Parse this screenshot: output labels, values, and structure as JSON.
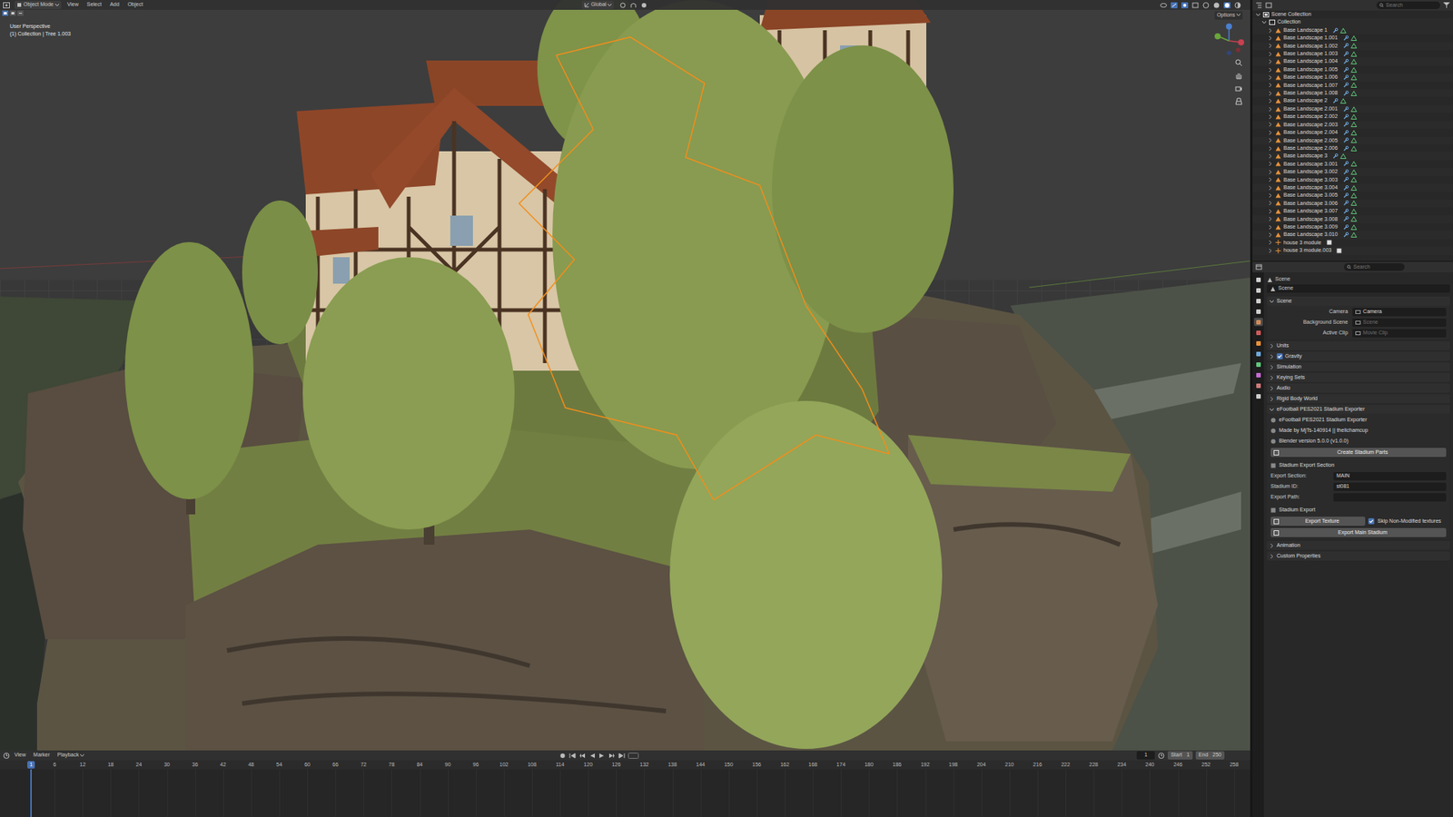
{
  "viewport": {
    "mode": "Object Mode",
    "menus": [
      "View",
      "Select",
      "Add",
      "Object"
    ],
    "orientation": "Global",
    "options": "Options",
    "view_name": "User Perspective",
    "info": "(1) Collection | Tree 1.003"
  },
  "outliner": {
    "search_placeholder": "Search",
    "root": {
      "label": "Scene Collection",
      "expanded": true
    },
    "collection": {
      "label": "Collection",
      "expanded": true
    },
    "items": [
      {
        "label": "Base Landscape 1",
        "kind": "mesh",
        "expanded": false,
        "selected": false
      },
      {
        "label": "Base Landscape 1.001",
        "kind": "mesh",
        "expanded": false,
        "selected": false
      },
      {
        "label": "Base Landscape 1.002",
        "kind": "mesh",
        "expanded": false,
        "selected": false
      },
      {
        "label": "Base Landscape 1.003",
        "kind": "mesh",
        "expanded": false,
        "selected": false
      },
      {
        "label": "Base Landscape 1.004",
        "kind": "mesh",
        "expanded": false,
        "selected": false
      },
      {
        "label": "Base Landscape 1.005",
        "kind": "mesh",
        "expanded": false,
        "selected": false
      },
      {
        "label": "Base Landscape 1.006",
        "kind": "mesh",
        "expanded": false,
        "selected": false
      },
      {
        "label": "Base Landscape 1.007",
        "kind": "mesh",
        "expanded": false,
        "selected": false
      },
      {
        "label": "Base Landscape 1.008",
        "kind": "mesh",
        "expanded": false,
        "selected": false
      },
      {
        "label": "Base Landscape 2",
        "kind": "mesh",
        "expanded": false,
        "selected": false
      },
      {
        "label": "Base Landscape 2.001",
        "kind": "mesh",
        "expanded": false,
        "selected": false
      },
      {
        "label": "Base Landscape 2.002",
        "kind": "mesh",
        "expanded": false,
        "selected": false
      },
      {
        "label": "Base Landscape 2.003",
        "kind": "mesh",
        "expanded": false,
        "selected": false
      },
      {
        "label": "Base Landscape 2.004",
        "kind": "mesh",
        "expanded": false,
        "selected": false
      },
      {
        "label": "Base Landscape 2.005",
        "kind": "mesh",
        "expanded": false,
        "selected": false
      },
      {
        "label": "Base Landscape 2.006",
        "kind": "mesh",
        "expanded": false,
        "selected": false
      },
      {
        "label": "Base Landscape 3",
        "kind": "mesh",
        "expanded": false,
        "selected": false
      },
      {
        "label": "Base Landscape 3.001",
        "kind": "mesh",
        "expanded": false,
        "selected": false
      },
      {
        "label": "Base Landscape 3.002",
        "kind": "mesh",
        "expanded": false,
        "selected": false
      },
      {
        "label": "Base Landscape 3.003",
        "kind": "mesh",
        "expanded": false,
        "selected": false
      },
      {
        "label": "Base Landscape 3.004",
        "kind": "mesh",
        "expanded": false,
        "selected": false
      },
      {
        "label": "Base Landscape 3.005",
        "kind": "mesh",
        "expanded": false,
        "selected": false
      },
      {
        "label": "Base Landscape 3.006",
        "kind": "mesh",
        "expanded": false,
        "selected": false
      },
      {
        "label": "Base Landscape 3.007",
        "kind": "mesh",
        "expanded": false,
        "selected": false
      },
      {
        "label": "Base Landscape 3.008",
        "kind": "mesh",
        "expanded": false,
        "selected": false
      },
      {
        "label": "Base Landscape 3.009",
        "kind": "mesh",
        "expanded": false,
        "selected": false
      },
      {
        "label": "Base Landscape 3.010",
        "kind": "mesh",
        "expanded": false,
        "selected": false
      },
      {
        "label": "house 3 module",
        "kind": "empty",
        "expanded": false,
        "selected": false
      },
      {
        "label": "house 3 module.003",
        "kind": "empty",
        "expanded": false,
        "selected": false
      }
    ]
  },
  "properties": {
    "search_placeholder": "Search",
    "breadcrumb": "Scene",
    "datablock": "Scene",
    "tabs": [
      {
        "selected": false
      },
      {
        "selected": false
      },
      {
        "selected": false
      },
      {
        "selected": false
      },
      {
        "selected": true
      },
      {
        "selected": false
      },
      {
        "selected": false
      },
      {
        "selected": false
      },
      {
        "selected": false
      },
      {
        "selected": false
      },
      {
        "selected": false
      },
      {
        "selected": false
      }
    ],
    "panels": [
      {
        "title": "Scene",
        "kind": "plain",
        "checked": false,
        "expanded": true,
        "rows": [
          {
            "kind": "field",
            "label": "Camera",
            "value": "Camera",
            "placeholder": false
          },
          {
            "kind": "field",
            "label": "Background Scene",
            "value": "Scene",
            "placeholder": true
          },
          {
            "kind": "field",
            "label": "Active Clip",
            "value": "Movie Clip",
            "placeholder": true
          }
        ]
      },
      {
        "title": "Units",
        "kind": "plain",
        "checked": false,
        "expanded": false,
        "rows": []
      },
      {
        "title": "Gravity",
        "kind": "checkbox",
        "checked": true,
        "expanded": false,
        "rows": []
      },
      {
        "title": "Simulation",
        "kind": "plain",
        "checked": false,
        "expanded": false,
        "rows": []
      },
      {
        "title": "Keying Sets",
        "kind": "plain",
        "checked": false,
        "expanded": false,
        "rows": []
      },
      {
        "title": "Audio",
        "kind": "plain",
        "checked": false,
        "expanded": false,
        "rows": []
      },
      {
        "title": "Rigid Body World",
        "kind": "plain",
        "checked": false,
        "expanded": false,
        "rows": []
      },
      {
        "title": "eFootball PES2021 Stadium Exporter",
        "kind": "plain",
        "checked": false,
        "expanded": true,
        "rows": [
          {
            "kind": "info",
            "text": "eFootball PES2021 Stadium Exporter"
          },
          {
            "kind": "info",
            "text": "Made by MjTs-140914 || thelichamcup"
          },
          {
            "kind": "info",
            "text": "Blender version 5.0.0 (v1.0.0)"
          },
          {
            "kind": "button",
            "text": "Create Stadium Parts"
          },
          {
            "kind": "heading",
            "text": "Stadium Export Section"
          },
          {
            "kind": "split",
            "label": "Export Section:",
            "value": "MAIN"
          },
          {
            "kind": "split",
            "label": "Stadium ID:",
            "value": "st081"
          },
          {
            "kind": "split",
            "label": "Export Path:",
            "value": ""
          },
          {
            "kind": "heading",
            "text": "Stadium Export"
          },
          {
            "kind": "buttoncheck",
            "text": "Export Texture",
            "check_label": "Skip Non-Modified textures",
            "checked": true
          },
          {
            "kind": "button",
            "text": "Export Main Stadium"
          }
        ]
      },
      {
        "title": "Animation",
        "kind": "plain",
        "checked": false,
        "expanded": false,
        "rows": []
      },
      {
        "title": "Custom Properties",
        "kind": "plain",
        "checked": false,
        "expanded": false,
        "rows": []
      }
    ]
  },
  "timeline": {
    "menus": [
      "View",
      "Marker",
      "Playback"
    ],
    "current_frame": "1",
    "start_label": "Start",
    "start": "1",
    "end_label": "End",
    "end": "250",
    "playhead": "1",
    "ruler": [
      "6",
      "12",
      "18",
      "24",
      "30",
      "36",
      "42",
      "48",
      "54",
      "60",
      "66",
      "72",
      "78",
      "84",
      "90",
      "96",
      "102",
      "108",
      "114",
      "120",
      "126",
      "132",
      "138",
      "144",
      "150",
      "156",
      "162",
      "168",
      "174",
      "180",
      "186",
      "192",
      "198",
      "204",
      "210",
      "216",
      "222",
      "228",
      "234",
      "240",
      "246",
      "252",
      "258"
    ]
  }
}
